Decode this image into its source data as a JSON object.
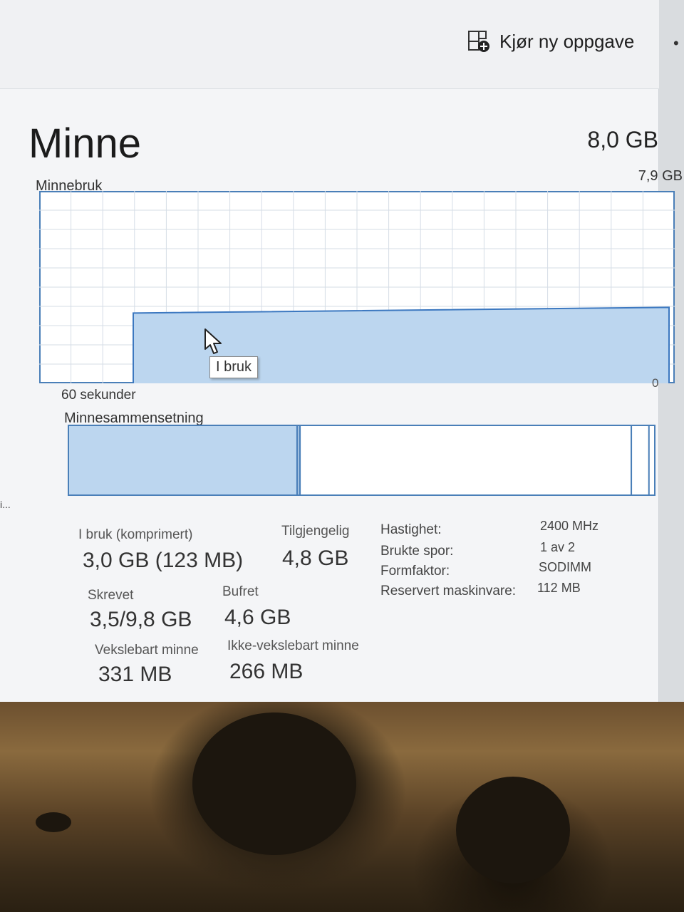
{
  "toolbar": {
    "run_new_task": "Kjør ny oppgave",
    "more": "•"
  },
  "side_ellipsis": "i...",
  "memory": {
    "title": "Minne",
    "total_capacity": "8,0 GB",
    "usage_graph": {
      "label": "Minnebruk",
      "max_label": "7,9 GB",
      "time_label": "60 sekunder",
      "zero_label": "0",
      "tooltip": "I bruk",
      "in_use_fraction": 0.38
    },
    "composition": {
      "label": "Minnesammensetning",
      "in_use_fraction": 0.39,
      "modified_fraction": 0.005,
      "standby_fraction": 0.565,
      "free_fraction": 0.03
    },
    "stats": {
      "in_use_label": "I bruk (komprimert)",
      "in_use_value": "3,0 GB (123 MB)",
      "available_label": "Tilgjengelig",
      "available_value": "4,8 GB",
      "committed_label": "Skrevet",
      "committed_value": "3,5/9,8 GB",
      "cached_label": "Bufret",
      "cached_value": "4,6 GB",
      "paged_pool_label": "Vekslebart minne",
      "paged_pool_value": "331 MB",
      "nonpaged_pool_label": "Ikke-vekslebart minne",
      "nonpaged_pool_value": "266 MB"
    },
    "specs": {
      "speed_label": "Hastighet:",
      "speed_value": "2400 MHz",
      "slots_label": "Brukte spor:",
      "slots_value": "1 av 2",
      "form_factor_label": "Formfaktor:",
      "form_factor_value": "SODIMM",
      "reserved_label": "Reservert maskinvare:",
      "reserved_value": "112 MB"
    }
  },
  "colors": {
    "graph_border": "#4a7fb8",
    "graph_fill": "#bcd6ef",
    "graph_line": "#3c78c0",
    "grid": "#d5dde6"
  }
}
